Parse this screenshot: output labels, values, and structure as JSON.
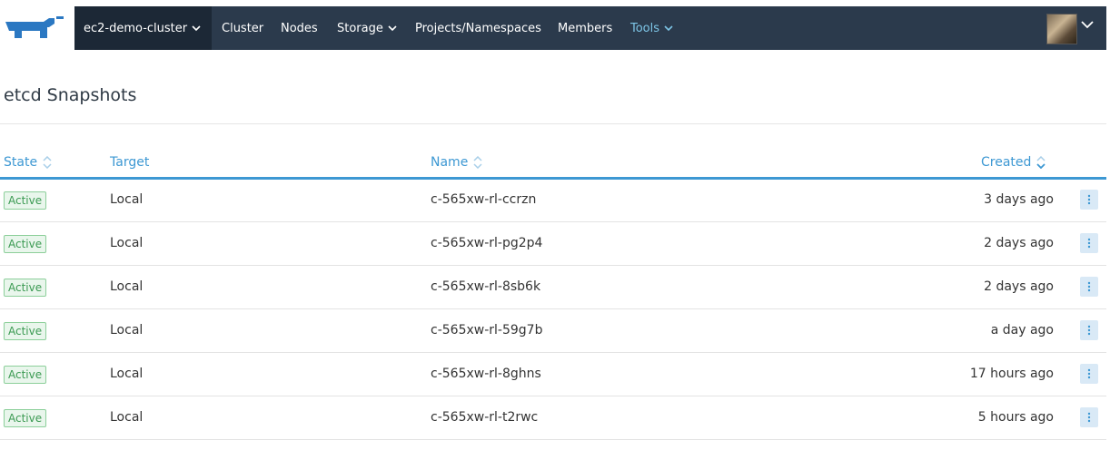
{
  "nav": {
    "cluster_name": "ec2-demo-cluster",
    "items": [
      {
        "label": "Cluster"
      },
      {
        "label": "Nodes"
      },
      {
        "label": "Storage"
      },
      {
        "label": "Projects/Namespaces"
      },
      {
        "label": "Members"
      },
      {
        "label": "Tools"
      }
    ]
  },
  "page": {
    "title": "etcd Snapshots"
  },
  "table": {
    "columns": {
      "state": "State",
      "target": "Target",
      "name": "Name",
      "created": "Created"
    },
    "rows": [
      {
        "state": "Active",
        "target": "Local",
        "name": "c-565xw-rl-ccrzn",
        "created": "3 days ago"
      },
      {
        "state": "Active",
        "target": "Local",
        "name": "c-565xw-rl-pg2p4",
        "created": "2 days ago"
      },
      {
        "state": "Active",
        "target": "Local",
        "name": "c-565xw-rl-8sb6k",
        "created": "2 days ago"
      },
      {
        "state": "Active",
        "target": "Local",
        "name": "c-565xw-rl-59g7b",
        "created": "a day ago"
      },
      {
        "state": "Active",
        "target": "Local",
        "name": "c-565xw-rl-8ghns",
        "created": "17 hours ago"
      },
      {
        "state": "Active",
        "target": "Local",
        "name": "c-565xw-rl-t2rwc",
        "created": "5 hours ago"
      }
    ]
  },
  "colors": {
    "nav_bg": "#2b3a4c",
    "accent": "#3d98d3",
    "badge_green": "#3b9a52",
    "tools_link": "#7dc5e6"
  },
  "icons": {
    "logo": "rancher-cow-logo",
    "sort": "sort-icon",
    "actions": "kebab-menu-icon"
  }
}
